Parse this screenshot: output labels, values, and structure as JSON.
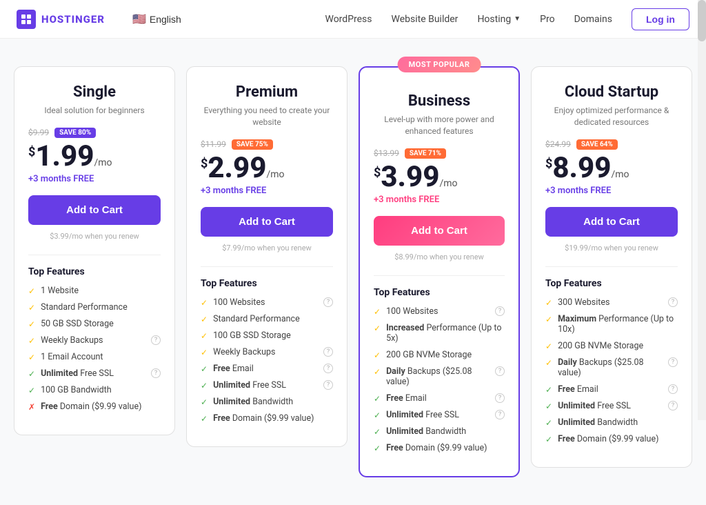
{
  "brand": {
    "name": "HOSTINGER"
  },
  "nav": {
    "lang": "English",
    "flag": "🇺🇸",
    "links": [
      {
        "label": "WordPress",
        "id": "wordpress"
      },
      {
        "label": "Website Builder",
        "id": "website-builder"
      },
      {
        "label": "Hosting",
        "id": "hosting",
        "hasDropdown": true
      },
      {
        "label": "Pro",
        "id": "pro"
      },
      {
        "label": "Domains",
        "id": "domains"
      }
    ],
    "login_label": "Log in"
  },
  "popular_badge": "MOST POPULAR",
  "plans": [
    {
      "id": "single",
      "title": "Single",
      "desc": "Ideal solution for beginners",
      "original_price": "$9.99",
      "save_label": "SAVE 80%",
      "save_color": "purple",
      "price_amount": "1.99",
      "period": "/mo",
      "free_months": "+3 months FREE",
      "free_months_color": "purple",
      "btn_label": "Add to Cart",
      "btn_color": "purple",
      "renew_price": "$3.99/mo when you renew",
      "is_popular": false,
      "features_title": "Top Features",
      "features": [
        {
          "text": "1 Website",
          "bold_prefix": "",
          "has_info": false,
          "check": "yellow"
        },
        {
          "text": "Standard Performance",
          "bold_prefix": "",
          "has_info": false,
          "check": "yellow"
        },
        {
          "text": "50 GB SSD Storage",
          "bold_prefix": "",
          "has_info": false,
          "check": "yellow"
        },
        {
          "text": "Weekly Backups",
          "bold_prefix": "",
          "has_info": true,
          "check": "yellow"
        },
        {
          "text": "1 Email Account",
          "bold_prefix": "",
          "has_info": false,
          "check": "yellow"
        },
        {
          "text": "Unlimited Free SSL",
          "bold_prefix": "Unlimited",
          "has_info": true,
          "check": "green"
        },
        {
          "text": "100 GB Bandwidth",
          "bold_prefix": "",
          "has_info": false,
          "check": "green"
        },
        {
          "text": "Free Domain ($9.99 value)",
          "bold_prefix": "Free",
          "has_info": false,
          "check": "red"
        }
      ]
    },
    {
      "id": "premium",
      "title": "Premium",
      "desc": "Everything you need to create your website",
      "original_price": "$11.99",
      "save_label": "SAVE 75%",
      "save_color": "orange",
      "price_amount": "2.99",
      "period": "/mo",
      "free_months": "+3 months FREE",
      "free_months_color": "purple",
      "btn_label": "Add to Cart",
      "btn_color": "purple",
      "renew_price": "$7.99/mo when you renew",
      "is_popular": false,
      "features_title": "Top Features",
      "features": [
        {
          "text": "100 Websites",
          "bold_prefix": "",
          "has_info": true,
          "check": "yellow"
        },
        {
          "text": "Standard Performance",
          "bold_prefix": "",
          "has_info": false,
          "check": "yellow"
        },
        {
          "text": "100 GB SSD Storage",
          "bold_prefix": "",
          "has_info": false,
          "check": "yellow"
        },
        {
          "text": "Weekly Backups",
          "bold_prefix": "",
          "has_info": true,
          "check": "yellow"
        },
        {
          "text": "Free Email",
          "bold_prefix": "Free",
          "has_info": true,
          "check": "green"
        },
        {
          "text": "Unlimited Free SSL",
          "bold_prefix": "Unlimited",
          "has_info": true,
          "check": "green"
        },
        {
          "text": "Unlimited Bandwidth",
          "bold_prefix": "Unlimited",
          "has_info": false,
          "check": "green"
        },
        {
          "text": "Free Domain ($9.99 value)",
          "bold_prefix": "Free",
          "has_info": false,
          "check": "green"
        }
      ]
    },
    {
      "id": "business",
      "title": "Business",
      "desc": "Level-up with more power and enhanced features",
      "original_price": "$13.99",
      "save_label": "SAVE 71%",
      "save_color": "orange",
      "price_amount": "3.99",
      "period": "/mo",
      "free_months": "+3 months FREE",
      "free_months_color": "pink",
      "btn_label": "Add to Cart",
      "btn_color": "pink",
      "renew_price": "$8.99/mo when you renew",
      "is_popular": true,
      "features_title": "Top Features",
      "features": [
        {
          "text": "100 Websites",
          "bold_prefix": "",
          "has_info": true,
          "check": "yellow"
        },
        {
          "text": "Increased Performance (Up to 5x)",
          "bold_prefix": "Increased",
          "has_info": false,
          "check": "yellow"
        },
        {
          "text": "200 GB NVMe Storage",
          "bold_prefix": "",
          "has_info": false,
          "check": "yellow"
        },
        {
          "text": "Daily Backups ($25.08 value)",
          "bold_prefix": "Daily",
          "has_info": true,
          "check": "yellow"
        },
        {
          "text": "Free Email",
          "bold_prefix": "Free",
          "has_info": true,
          "check": "green"
        },
        {
          "text": "Unlimited Free SSL",
          "bold_prefix": "Unlimited",
          "has_info": true,
          "check": "green"
        },
        {
          "text": "Unlimited Bandwidth",
          "bold_prefix": "Unlimited",
          "has_info": false,
          "check": "green"
        },
        {
          "text": "Free Domain ($9.99 value)",
          "bold_prefix": "Free",
          "has_info": false,
          "check": "green"
        }
      ]
    },
    {
      "id": "cloud-startup",
      "title": "Cloud Startup",
      "desc": "Enjoy optimized performance & dedicated resources",
      "original_price": "$24.99",
      "save_label": "SAVE 64%",
      "save_color": "orange",
      "price_amount": "8.99",
      "period": "/mo",
      "free_months": "+3 months FREE",
      "free_months_color": "purple",
      "btn_label": "Add to Cart",
      "btn_color": "purple",
      "renew_price": "$19.99/mo when you renew",
      "is_popular": false,
      "features_title": "Top Features",
      "features": [
        {
          "text": "300 Websites",
          "bold_prefix": "",
          "has_info": true,
          "check": "yellow"
        },
        {
          "text": "Maximum Performance (Up to 10x)",
          "bold_prefix": "Maximum",
          "has_info": false,
          "check": "yellow"
        },
        {
          "text": "200 GB NVMe Storage",
          "bold_prefix": "",
          "has_info": false,
          "check": "yellow"
        },
        {
          "text": "Daily Backups ($25.08 value)",
          "bold_prefix": "Daily",
          "has_info": true,
          "check": "yellow"
        },
        {
          "text": "Free Email",
          "bold_prefix": "Free",
          "has_info": true,
          "check": "green"
        },
        {
          "text": "Unlimited Free SSL",
          "bold_prefix": "Unlimited",
          "has_info": true,
          "check": "green"
        },
        {
          "text": "Unlimited Bandwidth",
          "bold_prefix": "Unlimited",
          "has_info": false,
          "check": "green"
        },
        {
          "text": "Free Domain ($9.99 value)",
          "bold_prefix": "Free",
          "has_info": false,
          "check": "green"
        }
      ]
    }
  ]
}
